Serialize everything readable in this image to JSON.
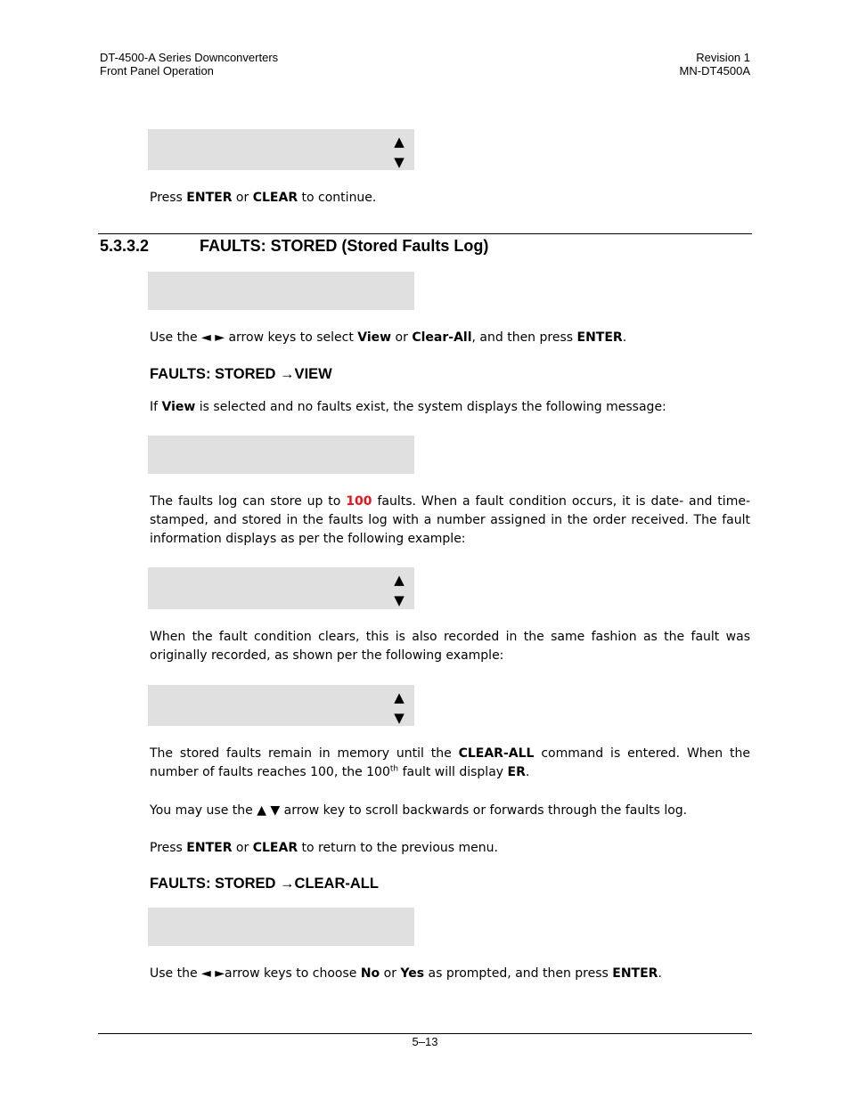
{
  "header": {
    "left_line1": "DT-4500-A Series Downconverters",
    "left_line2": "Front Panel Operation",
    "right_line1": "Revision 1",
    "right_line2": "MN-DT4500A"
  },
  "intro": {
    "continue_prefix": "Press ",
    "enter": "ENTER",
    "or": " or ",
    "clear": "CLEAR",
    "continue_suffix": " to continue."
  },
  "section": {
    "number": "5.3.3.2",
    "title": "FAULTS: STORED (Stored Faults Log)"
  },
  "select_text": {
    "prefix": "Use the ◄ ► arrow keys  to select ",
    "view": "View",
    "or": " or ",
    "clear_all": "Clear-All",
    "middle": ", and then press ",
    "enter": "ENTER",
    "suffix": "."
  },
  "view_heading": "FAULTS: STORED →VIEW",
  "view_text": {
    "prefix": "If ",
    "view": "View",
    "suffix": " is selected and no faults exist, the system displays the following message:"
  },
  "log_text": {
    "part1": "The faults log can store up to ",
    "count": "100",
    "part2": " faults. When a fault condition occurs, it is date- and time-stamped, and stored in the faults log with a number assigned in the order received. The fault information displays as per the following example:"
  },
  "clears_text": "When the fault condition clears, this is also recorded in the same fashion as the fault was originally recorded, as shown per the following example:",
  "memory_text": {
    "part1": "The stored faults remain in memory until the ",
    "clear_all": "CLEAR-ALL",
    "part2": " command is entered. When the number of faults reaches 100, the 100",
    "sup": "th",
    "part3": " fault will display ",
    "er": "ER",
    "part4": "."
  },
  "scroll_text": "You may use the ▲ ▼ arrow key to scroll backwards or forwards through the faults log.",
  "return_text": {
    "prefix": "Press ",
    "enter": "ENTER",
    "or": " or ",
    "clear": "CLEAR",
    "suffix": " to return to the previous menu."
  },
  "clear_heading": "FAULTS: STORED →CLEAR-ALL",
  "choose_text": {
    "prefix": "Use the ◄ ►arrow keys to choose ",
    "no": "No",
    "or": " or ",
    "yes": "Yes",
    "middle": " as prompted, and then press ",
    "enter": "ENTER",
    "suffix": "."
  },
  "arrows": {
    "up": "▲",
    "down": "▼"
  },
  "footer": {
    "page": "5–13"
  }
}
